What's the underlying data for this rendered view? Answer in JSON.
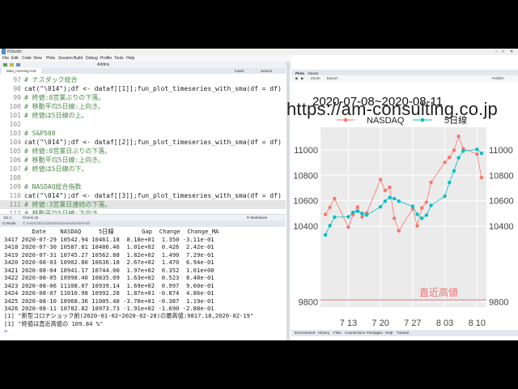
{
  "window": {
    "title": "RStudio"
  },
  "menu": {
    "items": [
      "File",
      "Edit",
      "Code",
      "View",
      "Plots",
      "Session",
      "Build",
      "Debug",
      "Profile",
      "Tools",
      "Help"
    ]
  },
  "toolbar": {
    "addins_label": "Addins",
    "insert_label": "Insert",
    "source_label": "Source"
  },
  "editor": {
    "file_tab": "data_morning.rmd",
    "lines": [
      {
        "n": "97",
        "text": "# ナスダック総合",
        "kind": "cm"
      },
      {
        "n": "98",
        "text": "cat(\"\\014\");df <- dataf[[1]];fun_plot_timeseries_with_sma(df = df)",
        "kind": "code"
      },
      {
        "n": "99",
        "text": "# 終値:8営業ぶりの下落。",
        "kind": "cm"
      },
      {
        "n": "100",
        "text": "# 移動平均5日線:上向き。",
        "kind": "cm"
      },
      {
        "n": "101",
        "text": "# 終値は5日線の上。",
        "kind": "cm"
      },
      {
        "n": "102",
        "text": "",
        "kind": "code"
      },
      {
        "n": "103",
        "text": "# S&P500",
        "kind": "cm"
      },
      {
        "n": "104",
        "text": "cat(\"\\014\");df <- dataf[[2]];fun_plot_timeseries_with_sma(df = df)",
        "kind": "code"
      },
      {
        "n": "105",
        "text": "# 終値:8営業日ぶりの下落。",
        "kind": "cm"
      },
      {
        "n": "106",
        "text": "# 移動平均5日線:上向き。",
        "kind": "cm"
      },
      {
        "n": "107",
        "text": "# 終値は5日線の下。",
        "kind": "cm"
      },
      {
        "n": "108",
        "text": "",
        "kind": "code"
      },
      {
        "n": "109",
        "text": "# NASDAQ総合指数",
        "kind": "cm"
      },
      {
        "n": "110",
        "text": "cat(\"\\014\");df <- dataf[[3]];fun_plot_timeseries_with_sma(df = df)",
        "kind": "code"
      },
      {
        "n": "111",
        "text": "# 終値:3営業日連続の下落。",
        "kind": "cm",
        "highlight": true
      },
      {
        "n": "112",
        "text": "# 移動平均5日線:下向き。",
        "kind": "cm"
      },
      {
        "n": "113",
        "text": "# 終値は5日線の下。",
        "kind": "cm"
      },
      {
        "n": "114",
        "text": "",
        "kind": "code"
      }
    ],
    "status_position": "111:1",
    "status_chunk": "Chunk 15",
    "status_mode": "R Markdown"
  },
  "console": {
    "tab": "Console",
    "path": "C:/Users/2014/2020/hasone/website/rmd/ ",
    "header": "        Date    NASDAQ     5日線        Gap  Change  Change_MA",
    "rows": [
      "3417 2020-07-29 10542.94 10461.18  8.18e+01  1.350 -3.11e-01",
      "3418 2020-07-30 10587.81 10486.46  1.01e+02  0.426  2.42e-01",
      "3419 2020-07-31 10745.27 10562.88  1.82e+02  1.490  7.29e-01",
      "3420 2020-08-03 10902.80 10636.18  2.67e+02  1.470  6.94e-01",
      "3421 2020-08-04 10941.17 10744.00  1.97e+02  0.352  1.01e+00",
      "3422 2020-08-05 10998.40 10835.09  1.63e+02  0.523  8.48e-01",
      "3423 2020-08-06 11108.07 10939.14  1.69e+02  0.997  9.60e-01",
      "3424 2020-08-07 11010.98 10992.28  1.87e+01 -0.874  4.86e-01",
      "3425 2020-08-10 10968.36 11005.40 -3.70e+01 -0.387  1.19e-01",
      "3426 2020-08-11 10782.82 10973.73 -1.91e+02 -1.690 -2.88e-01"
    ],
    "msg1": "[1] \"新型コロナショック前(2020-01-02~2020-02-28)の最高値:9817.18,2020-02-19\"",
    "msg2": "[1] \"終値は直近高値の 109.84 %\"",
    "prompt": ">"
  },
  "right_pane": {
    "tabs": [
      "Plots",
      "Viewer"
    ],
    "tools": [
      "Zoom",
      "Export",
      "Publish"
    ],
    "bottom_tabs": [
      "Environment",
      "History",
      "Files",
      "Connections",
      "Packages",
      "Help",
      "Tutorial"
    ]
  },
  "watermark": "https://am-consulting.co.jp",
  "chart_data": {
    "type": "line",
    "title": "2020-07-08~2020-08-11",
    "x": [
      "2020-07-08",
      "2020-07-09",
      "2020-07-10",
      "2020-07-13",
      "2020-07-14",
      "2020-07-15",
      "2020-07-16",
      "2020-07-17",
      "2020-07-20",
      "2020-07-21",
      "2020-07-22",
      "2020-07-23",
      "2020-07-24",
      "2020-07-27",
      "2020-07-28",
      "2020-07-29",
      "2020-07-30",
      "2020-07-31",
      "2020-08-03",
      "2020-08-04",
      "2020-08-05",
      "2020-08-06",
      "2020-08-07",
      "2020-08-10",
      "2020-08-11"
    ],
    "x_ticks": [
      "7 13",
      "7 20",
      "7 27",
      "8 03",
      "8 10"
    ],
    "series": [
      {
        "name": "NASDAQ",
        "color": "#f8766d",
        "values": [
          10492,
          10548,
          10617,
          10391,
          10488,
          10550,
          10473,
          10503,
          10767,
          10681,
          10706,
          10461,
          10363,
          10537,
          10402,
          10543,
          10588,
          10745,
          10903,
          10941,
          10998,
          11108,
          11011,
          10968,
          10783
        ]
      },
      {
        "name": "5日線",
        "color": "#00bfc4",
        "values": [
          10330,
          10404,
          10470,
          10473,
          10507,
          10517,
          10500,
          10487,
          10552,
          10596,
          10625,
          10617,
          10596,
          10556,
          10493,
          10461,
          10486,
          10563,
          10636,
          10744,
          10835,
          10939,
          10992,
          11005,
          10974
        ]
      }
    ],
    "y_ticks": [
      9800,
      10400,
      10600,
      10800,
      11000
    ],
    "ylim": [
      9760,
      11180
    ],
    "annotation": {
      "label": "直近高値",
      "value": 9817.18,
      "color": "#f07070"
    }
  }
}
